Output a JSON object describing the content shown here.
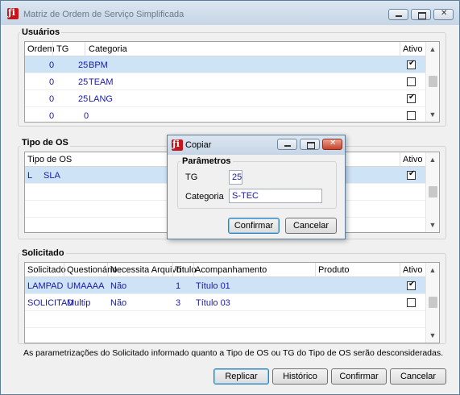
{
  "window": {
    "title": "Matriz de Ordem de Serviço Simplificada"
  },
  "usuarios": {
    "label": "Usuários",
    "headers": {
      "ordem": "Ordem",
      "tg": "TG",
      "categoria": "Categoria",
      "ativo": "Ativo"
    },
    "rows": [
      {
        "ordem": "0",
        "tg": "25",
        "categoria": "BPM",
        "ativo": true
      },
      {
        "ordem": "0",
        "tg": "25",
        "categoria": "TEAM",
        "ativo": false
      },
      {
        "ordem": "0",
        "tg": "25",
        "categoria": "LANG",
        "ativo": true
      },
      {
        "ordem": "0",
        "tg": "0",
        "categoria": "",
        "ativo": false
      }
    ]
  },
  "tipo_os": {
    "label": "Tipo de OS",
    "headers": {
      "tipo": "Tipo de OS",
      "ativo": "Ativo"
    },
    "rows": [
      {
        "codigo": "L",
        "nome": "SLA",
        "ativo": true
      }
    ]
  },
  "solicitado": {
    "label": "Solicitado",
    "headers": {
      "solicitado": "Solicitado",
      "questionario": "Questionário",
      "necessita": "Necessita Arquivo",
      "titulo": "Titulo",
      "acompanhamento": "Acompanhamento",
      "produto": "Produto",
      "ativo": "Ativo"
    },
    "rows": [
      {
        "solicitado": "LAMPAD",
        "questionario": "UMAAAA",
        "necessita": "Não",
        "titulo": "1",
        "acompanhamento": "Título 01",
        "produto": "",
        "ativo": true
      },
      {
        "solicitado": "SOLICITAD",
        "questionario": "Multip",
        "necessita": "Não",
        "titulo": "3",
        "acompanhamento": "Título 03",
        "produto": "",
        "ativo": false
      }
    ]
  },
  "note": "As parametrizações do Solicitado informado quanto a Tipo de OS ou TG do Tipo de OS serão desconsideradas.",
  "buttons": {
    "replicar": "Replicar",
    "historico": "Histórico",
    "confirmar": "Confirmar",
    "cancelar": "Cancelar"
  },
  "dialog": {
    "title": "Copiar",
    "group_label": "Parâmetros",
    "tg_label": "TG",
    "tg_value": "25",
    "categoria_label": "Categoria",
    "categoria_value": "S-TEC",
    "confirmar": "Confirmar",
    "cancelar": "Cancelar"
  }
}
